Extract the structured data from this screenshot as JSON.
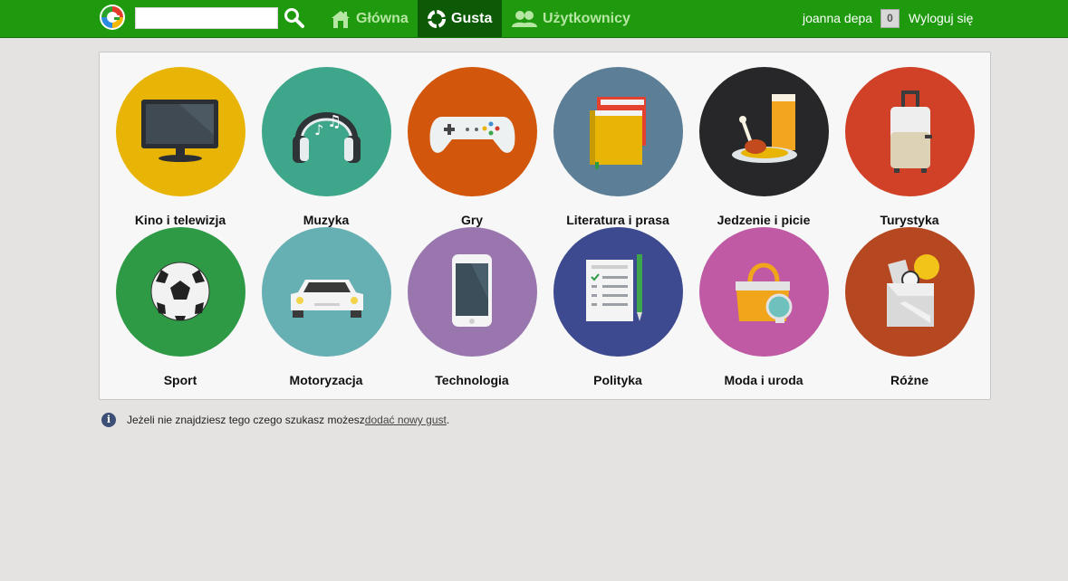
{
  "header": {
    "search_placeholder": "",
    "nav": [
      {
        "label": "Główna",
        "icon": "home-icon"
      },
      {
        "label": "Gusta",
        "icon": "gusta-logo-icon",
        "active": true
      },
      {
        "label": "Użytkownicy",
        "icon": "users-icon"
      }
    ],
    "user_name": "joanna depa",
    "notification_count": "0",
    "logout_label": "Wyloguj się"
  },
  "categories": [
    {
      "label": "Kino i telewizja",
      "color": "#e8b405",
      "icon": "tv-icon"
    },
    {
      "label": "Muzyka",
      "color": "#3ea68a",
      "icon": "headphones-icon"
    },
    {
      "label": "Gry",
      "color": "#d2570c",
      "icon": "gamepad-icon"
    },
    {
      "label": "Literatura i prasa",
      "color": "#5c7e96",
      "icon": "books-icon"
    },
    {
      "label": "Jedzenie i picie",
      "color": "#272628",
      "icon": "food-icon"
    },
    {
      "label": "Turystyka",
      "color": "#d04128",
      "icon": "suitcase-icon"
    },
    {
      "label": "Sport",
      "color": "#2e9a45",
      "icon": "football-icon"
    },
    {
      "label": "Motoryzacja",
      "color": "#66afb3",
      "icon": "car-icon"
    },
    {
      "label": "Technologia",
      "color": "#9977ae",
      "icon": "smartphone-icon"
    },
    {
      "label": "Polityka",
      "color": "#3e4a8f",
      "icon": "document-pen-icon"
    },
    {
      "label": "Moda i uroda",
      "color": "#c05aa5",
      "icon": "handbag-icon"
    },
    {
      "label": "Różne",
      "color": "#b54721",
      "icon": "box-icon"
    }
  ],
  "info": {
    "text": "Jeżeli nie znajdziesz tego czego szukasz możesz ",
    "link": "dodać nowy gust",
    "suffix": "."
  }
}
